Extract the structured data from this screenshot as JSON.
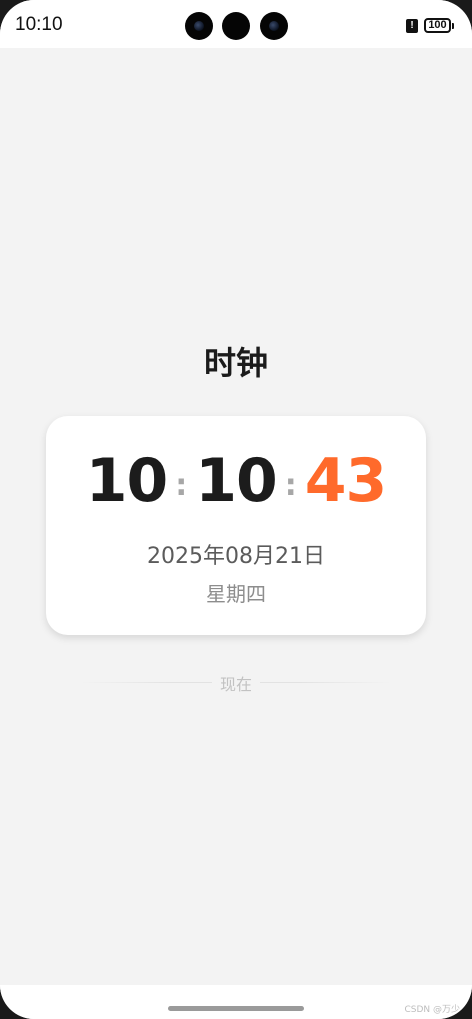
{
  "status_bar": {
    "time": "10:10",
    "alert_symbol": "!",
    "battery_level": "100",
    "icons": [
      "front-camera",
      "alert-icon",
      "battery-icon"
    ]
  },
  "page": {
    "title": "时钟"
  },
  "clock": {
    "hours": "10",
    "separator": ":",
    "minutes": "10",
    "seconds": "43",
    "seconds_color": "#ff6a2b",
    "date": "2025年08月21日",
    "weekday": "星期四"
  },
  "now_label": "现在",
  "watermark": "CSDN @万少"
}
